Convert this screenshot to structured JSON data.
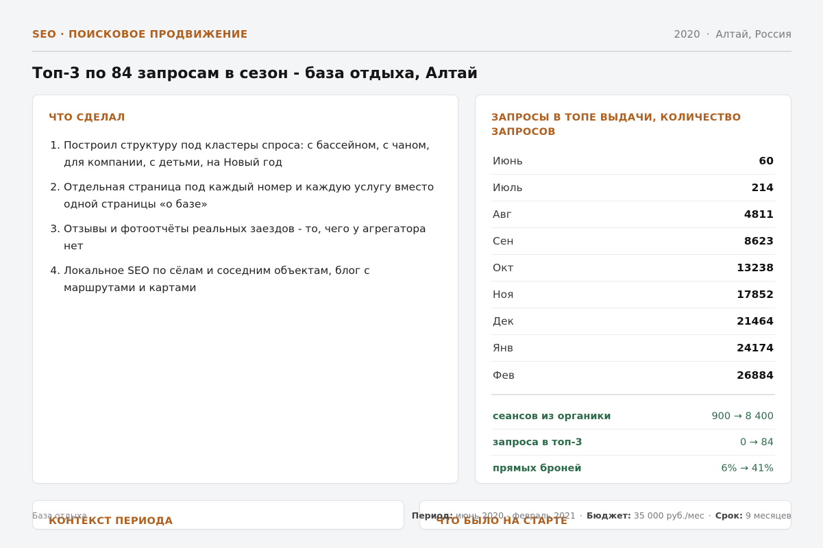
{
  "header": {
    "eyebrow": "SEO · ПОИСКОВОЕ ПРОДВИЖЕНИЕ",
    "year": "2020",
    "location": "Алтай, Россия"
  },
  "title": "Топ-3 по 84 запросам в сезон - база отдыха, Алтай",
  "done": {
    "heading": "Что сделал",
    "items": [
      "Построил структуру под кластеры спроса: с бассейном, с чаном, для компании, с детьми, на Новый год",
      "Отдельная страница под каждый номер и каждую услугу вместо одной страницы «о базе»",
      "Отзывы и фотоотчёты реальных заездов - то, чего у агрегатора нет",
      "Локальное SEO по сёлам и соседним объектам, блог с маршрутами и картами"
    ]
  },
  "queries": {
    "heading": "Запросы в топе выдачи, количество запросов",
    "rows": [
      {
        "month": "Июнь",
        "value": "60"
      },
      {
        "month": "Июль",
        "value": "214"
      },
      {
        "month": "Авг",
        "value": "4811"
      },
      {
        "month": "Сен",
        "value": "8623"
      },
      {
        "month": "Окт",
        "value": "13238"
      },
      {
        "month": "Ноя",
        "value": "17852"
      },
      {
        "month": "Дек",
        "value": "21464"
      },
      {
        "month": "Янв",
        "value": "24174"
      },
      {
        "month": "Фев",
        "value": "26884"
      }
    ],
    "results": [
      {
        "label": "сеансов из органики",
        "value": "900 → 8 400"
      },
      {
        "label": "запроса в топ-3",
        "value": "0 → 84"
      },
      {
        "label": "прямых броней",
        "value": "6% → 41%"
      }
    ]
  },
  "bottom": {
    "context_heading": "Контекст периода",
    "start_heading": "Что было на старте",
    "caption": "База отдыха",
    "period_label": "Период:",
    "period_value": "июнь 2020 - февраль 2021",
    "budget_label": "Бюджет:",
    "budget_value": "35 000 руб./мес",
    "term_label": "Срок:",
    "term_value": "9 месяцев"
  },
  "colors": {
    "accent": "#b0601f",
    "result_green": "#2e6b4a",
    "background": "#f4f5f7"
  }
}
